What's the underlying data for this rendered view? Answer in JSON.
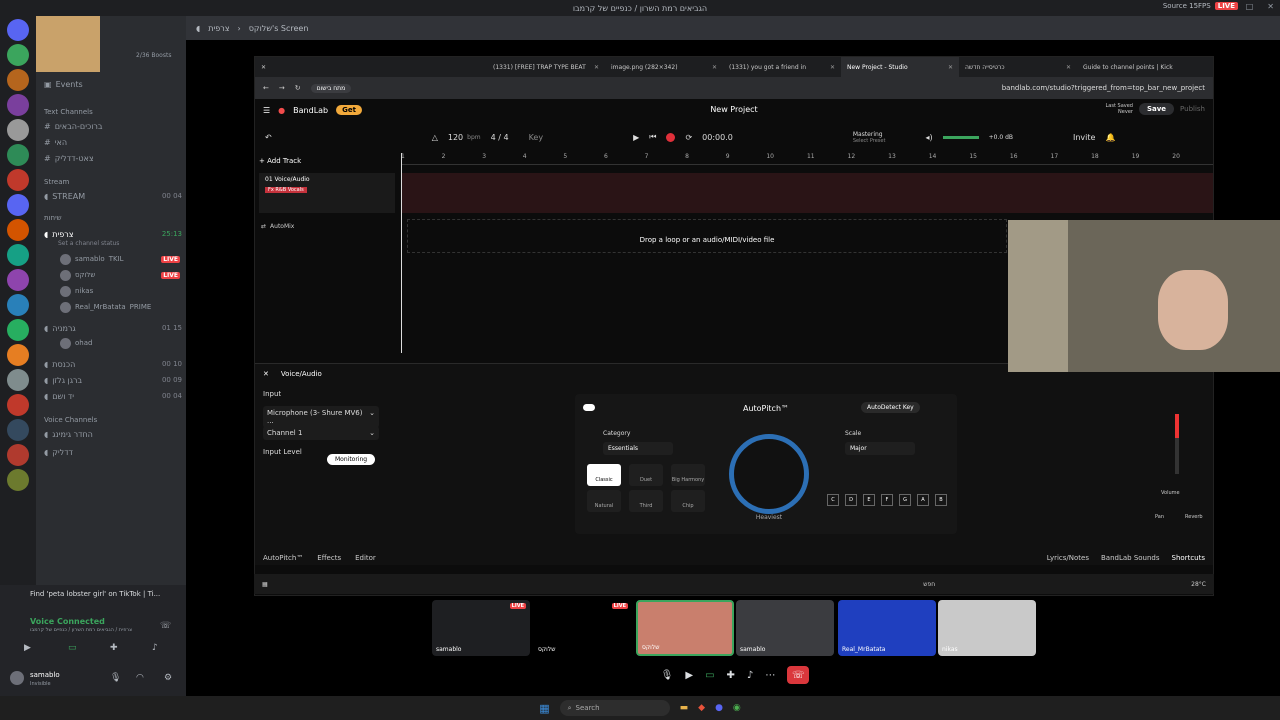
{
  "window": {
    "title": "הגביאים רמת השרון / כנפיים של קרמבו",
    "stream_fps": "Source 15FPS",
    "live": "LIVE"
  },
  "sidebar": {
    "boosts": "2/36 Boosts",
    "events": "Events",
    "categories": {
      "text": "Text Channels",
      "stream": "Stream",
      "voice_cat": "שיחות",
      "voice": "Voice Channels"
    },
    "text_channels": [
      {
        "label": "ברוכים-הבאים"
      },
      {
        "label": "האי"
      },
      {
        "label": "צאט-דדליק"
      }
    ],
    "stream_channel": "STREAM",
    "voice_channels": [
      {
        "label": "צרפית",
        "count": "25:13",
        "status": "Set a channel status"
      },
      {
        "label": "גרמניה",
        "count": "01 15"
      },
      {
        "label": "הכנסת",
        "count": "00 10"
      },
      {
        "label": "ברגן גלזן",
        "count": "00 09"
      },
      {
        "label": "יד ושם",
        "count": "00 04"
      },
      {
        "label": "החדר גימינג"
      },
      {
        "label": "דדליק"
      }
    ],
    "users": [
      {
        "name": "samablo",
        "tag": "TKIL",
        "live": "LIVE"
      },
      {
        "name": "שלוקס",
        "live": "LIVE"
      },
      {
        "name": "nikas"
      },
      {
        "name": "Real_MrBatata",
        "tag": "PRIME"
      },
      {
        "name": "ohad"
      }
    ],
    "stream_count": "00 04"
  },
  "userpanel": {
    "activity": "Find 'peta lobster girl' on TikTok | Ti...",
    "voice_status": "Voice Connected",
    "voice_location": "צרפית / הגביאים רמת השרון / כנפיים של קרמבו",
    "username": "samablo",
    "user_status": "Invisible"
  },
  "header": {
    "channel": "צרפית",
    "screen": "שלוקס's Screen"
  },
  "browser": {
    "tabs": [
      {
        "label": "(1331) [FREE] TRAP TYPE BEAT"
      },
      {
        "label": "image.png (282×342)"
      },
      {
        "label": "(1331) you got a friend in"
      },
      {
        "label": "New Project - Studio"
      },
      {
        "label": "כרטיסייה חדשה"
      },
      {
        "label": "Guide to channel points | Kick"
      }
    ],
    "url": "bandlab.com/studio?triggered_from=top_bar_new_project",
    "pill": "מתח בישום"
  },
  "bandlab": {
    "brand": "BandLab",
    "get": "Get",
    "project": "New Project",
    "last_saved": "Last Saved",
    "never": "Never",
    "save": "Save",
    "publish": "Publish",
    "bpm": "120",
    "bpm_unit": "bpm",
    "time_sig": "4 / 4",
    "key": "Key",
    "time": "00:00.0",
    "mastering": "Mastering",
    "preset": "Select Preset",
    "db": "+0.0 dB",
    "invite": "Invite",
    "add_track": "Add Track",
    "ruler": [
      "1",
      "2",
      "3",
      "4",
      "5",
      "6",
      "7",
      "8",
      "9",
      "10",
      "11",
      "12",
      "13",
      "14",
      "15",
      "16",
      "17",
      "18",
      "19",
      "20"
    ],
    "track_name": "01 Voice/Audio",
    "track_label": "Fx R&B Vocals",
    "automix": "AutoMix",
    "drop": "Drop a loop or an audio/MIDI/video file",
    "panel_title": "Voice/Audio",
    "input": "Input",
    "mic": "Microphone (3- Shure MV6) ...",
    "channel": "Channel 1",
    "input_level": "Input Level",
    "monitoring": "Monitoring",
    "autopitch": "AutoPitch™",
    "autodetect": "AutoDetect Key",
    "category": "Category",
    "category_val": "Essentials",
    "scale": "Scale",
    "scale_val": "Major",
    "heaviest": "Heaviest",
    "opts": [
      "Classic",
      "Duet",
      "Big Harmony",
      "Natural",
      "Third",
      "Chip"
    ],
    "keys": [
      "C",
      "D",
      "E",
      "F",
      "G",
      "A",
      "B"
    ],
    "volume": "Volume",
    "pan": "Pan",
    "reverb": "Reverb",
    "foot": [
      "AutoPitch™",
      "Effects",
      "Editor"
    ],
    "foot_right": [
      "Lyrics/Notes",
      "BandLab Sounds",
      "Shortcuts"
    ]
  },
  "winbar": {
    "weather": "28°C",
    "search": "חפש"
  },
  "tiles": [
    {
      "name": "samablo",
      "live": "LIVE"
    },
    {
      "name": "שלוקס",
      "live": "LIVE"
    },
    {
      "name": "שלוקס"
    },
    {
      "name": "samablo"
    },
    {
      "name": "Real_MrBatata"
    },
    {
      "name": "nikas"
    }
  ],
  "taskbar": {
    "search": "Search"
  }
}
